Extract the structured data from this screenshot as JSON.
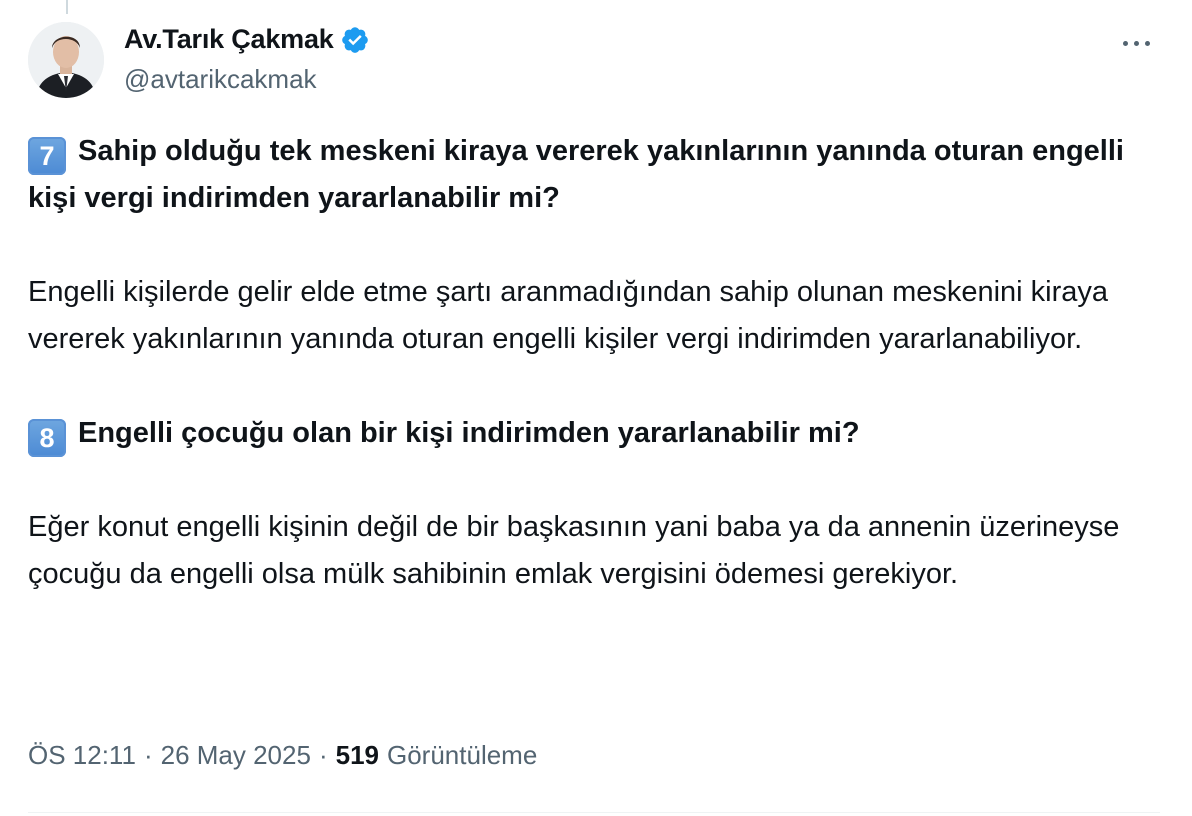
{
  "author": {
    "display_name": "Av.Tarık Çakmak",
    "handle": "@avtarikcakmak",
    "verified": true,
    "avatar": "profile-photo"
  },
  "tweet": {
    "items": [
      {
        "number": "7",
        "question": "Sahip olduğu tek meskeni kiraya vererek yakınlarının yanında oturan engelli kişi vergi indirimden yararlanabilir mi?",
        "answer": "Engelli kişilerde gelir elde etme şartı aranmadığından sahip olunan meskenini kiraya vererek yakınlarının yanında oturan engelli kişiler vergi indirimden yararlanabiliyor."
      },
      {
        "number": "8",
        "question": "Engelli çocuğu olan bir kişi indirimden yararlanabilir mi?",
        "answer": "Eğer konut engelli kişinin değil de bir başkasının yani baba ya da annenin üzerineyse çocuğu da engelli olsa mülk sahibinin emlak vergisini ödemesi gerekiyor."
      }
    ]
  },
  "meta": {
    "time": "ÖS 12:11",
    "separator": "·",
    "date": "26 May 2025",
    "views_count": "519",
    "views_label": "Görüntüleme"
  },
  "colors": {
    "text": "#0f1419",
    "secondary": "#536471",
    "verified_badge": "#1d9bf0",
    "keycap": "#5a92d6"
  },
  "icons": {
    "verified": "verified-badge-icon",
    "more": "more-options-icon"
  }
}
